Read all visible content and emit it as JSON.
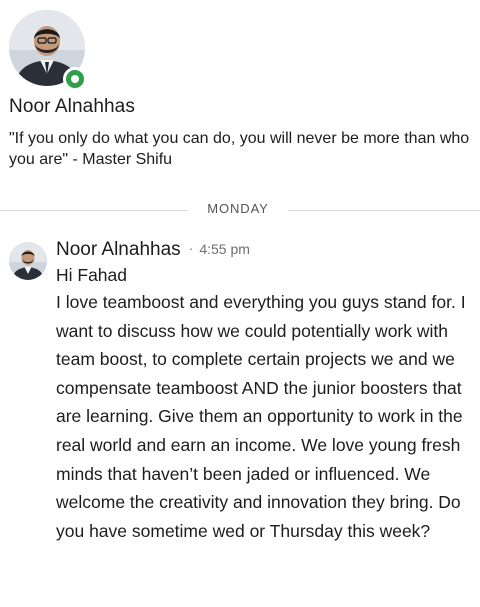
{
  "profile": {
    "name": "Noor Alnahhas",
    "status_quote": "\"If you only do what you can do, you will never be more than who you are\" - Master Shifu",
    "presence": "online"
  },
  "divider": {
    "day_label": "MONDAY"
  },
  "message": {
    "author": "Noor Alnahhas",
    "separator": "·",
    "time": "4:55 pm",
    "greeting": "Hi Fahad",
    "body": "I love teamboost and everything you guys stand for. I want to discuss how we could potentially work with team boost, to complete certain projects we and we compensate teamboost AND the junior boosters that are learning. Give them an opportunity to work in the real world and earn an income. We love young fresh minds that haven’t been jaded or influenced. We welcome the creativity and innovation they bring. Do you have sometime wed or Thursday this week?"
  },
  "colors": {
    "presence_green": "#2e9e49",
    "divider_line": "#dadada",
    "text": "#1d1d1d",
    "muted_text": "#6f6f6f"
  }
}
